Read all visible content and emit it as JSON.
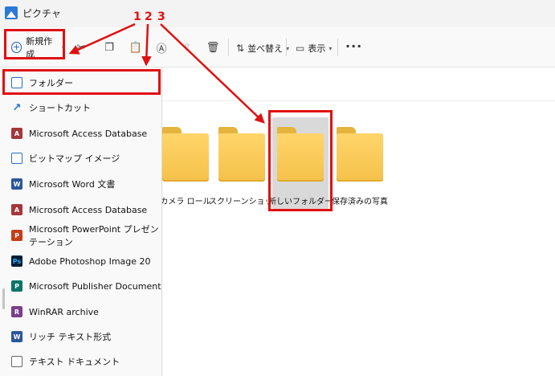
{
  "window": {
    "title": "ピクチャ"
  },
  "toolbar": {
    "new_label": "新規作成",
    "sort_label": "並べ替え",
    "view_label": "表示",
    "more_label": "···"
  },
  "context_menu": {
    "items": [
      {
        "label": "フォルダー",
        "icon": "folder-plus-icon"
      },
      {
        "label": "ショートカット",
        "icon": "shortcut-icon"
      },
      {
        "label": "Microsoft Access Database",
        "icon": "access-icon"
      },
      {
        "label": "ビットマップ イメージ",
        "icon": "bitmap-icon"
      },
      {
        "label": "Microsoft Word 文書",
        "icon": "word-icon"
      },
      {
        "label": "Microsoft Access Database",
        "icon": "access-icon"
      },
      {
        "label": "Microsoft PowerPoint プレゼンテーション",
        "icon": "powerpoint-icon"
      },
      {
        "label": "Adobe Photoshop Image 20",
        "icon": "photoshop-icon"
      },
      {
        "label": "Microsoft Publisher Document",
        "icon": "publisher-icon"
      },
      {
        "label": "WinRAR archive",
        "icon": "winrar-icon"
      },
      {
        "label": "リッチ テキスト形式",
        "icon": "rich-text-icon"
      },
      {
        "label": "テキスト ドキュメント",
        "icon": "text-document-icon"
      }
    ]
  },
  "folders": [
    {
      "name": "カメラ ロール"
    },
    {
      "name": "スクリーンショット"
    },
    {
      "name": "新しいフォルダー"
    },
    {
      "name": "保存済みの写真"
    }
  ],
  "annotations": {
    "steps": [
      "1",
      "2",
      "3"
    ],
    "color": "#e01010"
  }
}
